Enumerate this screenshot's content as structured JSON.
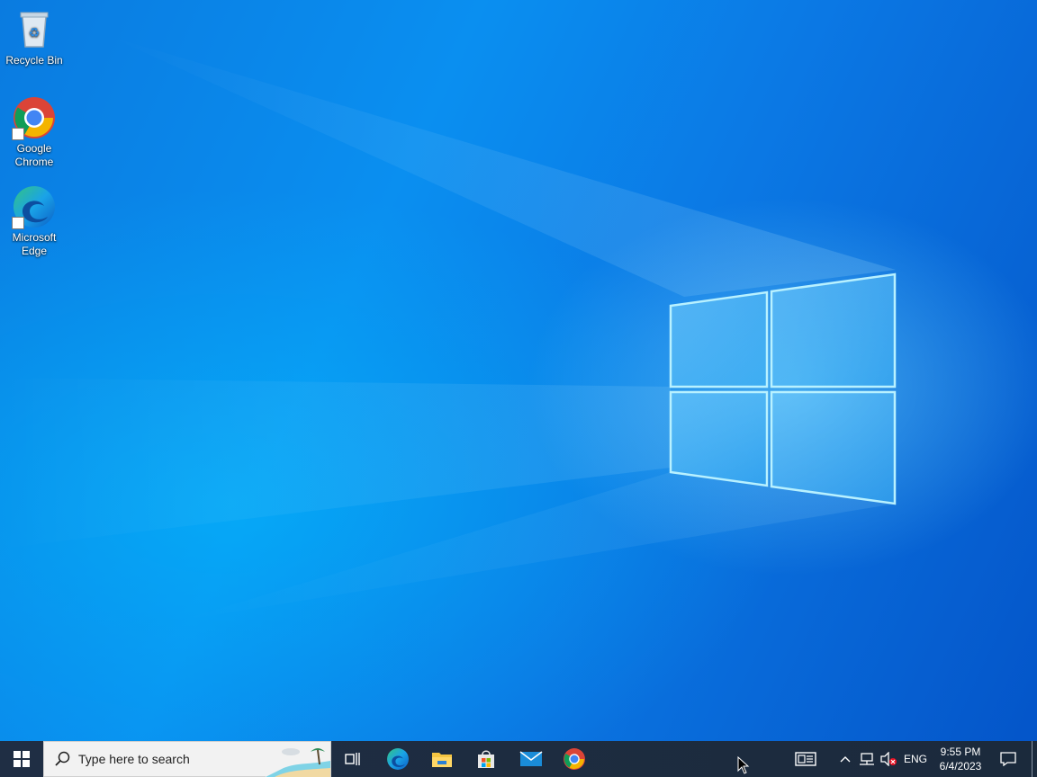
{
  "desktop": {
    "icons": [
      {
        "label": "Recycle Bin"
      },
      {
        "label": "Google\nChrome"
      },
      {
        "label": "Microsoft\nEdge"
      }
    ],
    "wallpaper": "Windows 10 hero"
  },
  "taskbar": {
    "search_placeholder": "Type here to search",
    "apps": [
      {
        "name": "task-view-icon"
      },
      {
        "name": "edge-icon"
      },
      {
        "name": "file-explorer-icon"
      },
      {
        "name": "microsoft-store-icon"
      },
      {
        "name": "mail-icon"
      },
      {
        "name": "chrome-icon"
      }
    ],
    "tray": {
      "language": "ENG",
      "time": "9:55 PM",
      "date": "6/4/2023"
    }
  },
  "colors": {
    "accent": "#0a84ee",
    "taskbar": "#1d2a3a"
  }
}
